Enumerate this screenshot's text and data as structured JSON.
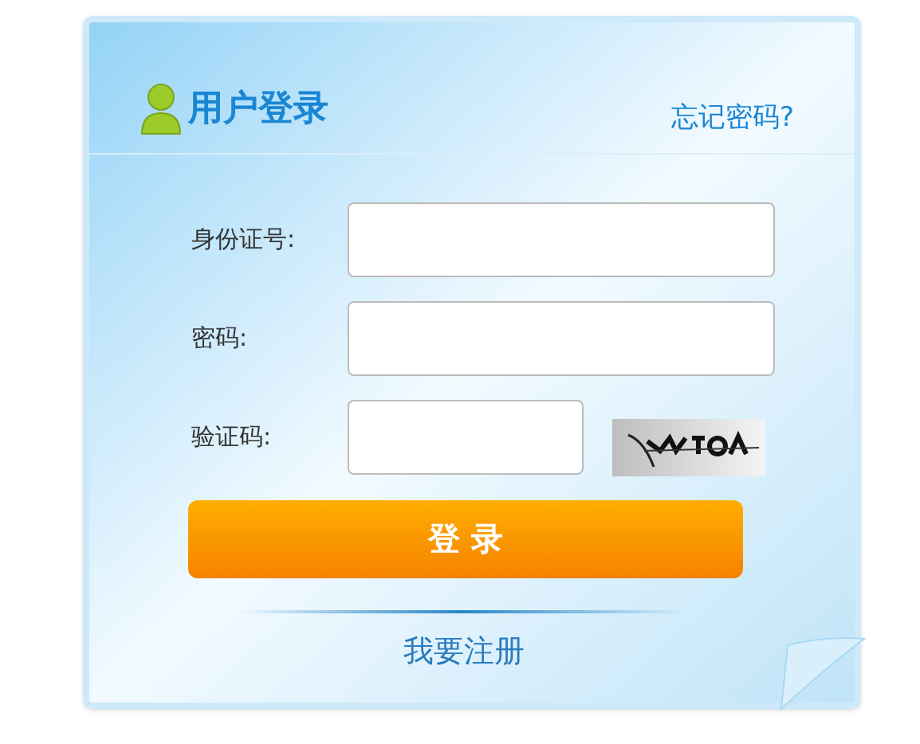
{
  "title": "用户登录",
  "forgot_link": "忘记密码?",
  "fields": [
    {
      "label": "身份证号:",
      "kind": "text"
    },
    {
      "label": "密码:",
      "kind": "text"
    },
    {
      "label": "验证码:",
      "kind": "captcha"
    }
  ],
  "login_button": "登 录",
  "register_link": "我要注册"
}
